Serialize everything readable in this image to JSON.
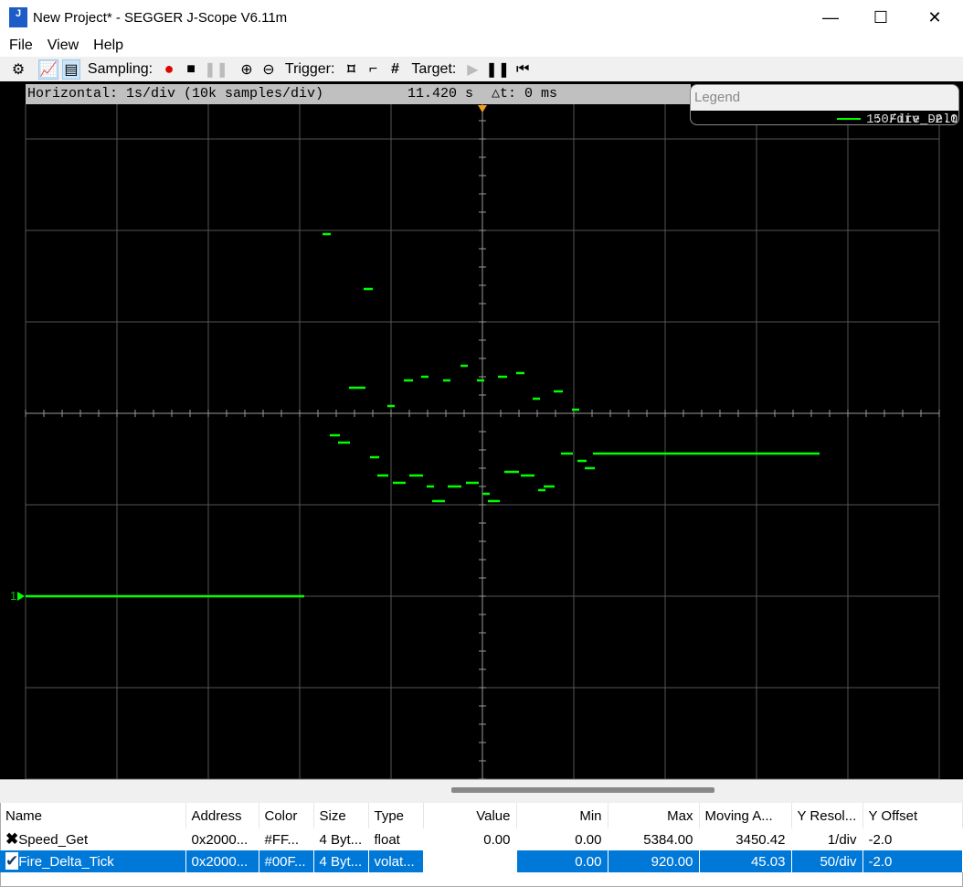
{
  "window": {
    "title": "New Project* - SEGGER J-Scope V6.11m",
    "icon_text": "J"
  },
  "menu": [
    "File",
    "View",
    "Help"
  ],
  "toolbar": {
    "sampling_label": "Sampling:",
    "trigger_label": "Trigger:",
    "target_label": "Target:"
  },
  "scope": {
    "horizontal": "Horizontal: 1s/div (10k samples/div)",
    "time": "11.420 s",
    "delta": "△t: 0 ms",
    "channel_marker": "1"
  },
  "legend": {
    "title": "Legend",
    "entry": "1: Fire_Delt",
    "entry_scale": "50/div -2.0"
  },
  "colors": {
    "trace": "#00ff00",
    "selection": "#0078d7",
    "trigger": "#f0a020"
  },
  "table": {
    "headers": [
      "Name",
      "Address",
      "Color",
      "Size",
      "Type",
      "Value",
      "Min",
      "Max",
      "Moving A...",
      "Y Resol...",
      "Y Offset"
    ],
    "rows": [
      {
        "checked": false,
        "cells": [
          "Speed_Get",
          "0x2000...",
          "#FF...",
          "4 Byt...",
          "float",
          "0.00",
          "0.00",
          "5384.00",
          "3450.42",
          "1/div",
          "-2.0"
        ]
      },
      {
        "checked": true,
        "selected": true,
        "cells": [
          "Fire_Delta_Tick",
          "0x2000...",
          "#00F...",
          "4 Byt...",
          "volat...",
          "",
          "0.00",
          "920.00",
          "45.03",
          "50/div",
          "-2.0"
        ]
      }
    ]
  },
  "chart_data": {
    "type": "line",
    "series": [
      {
        "name": "Fire_Delta_Tick",
        "y_per_div": 50,
        "y_offset_div": -2.0,
        "segments": [
          [
            6.42,
            9.47,
            0
          ],
          [
            9.67,
            9.76,
            198
          ],
          [
            10.12,
            10.22,
            168
          ],
          [
            9.96,
            10.14,
            114
          ],
          [
            10.38,
            10.46,
            104
          ],
          [
            10.56,
            10.66,
            118
          ],
          [
            10.75,
            10.83,
            120
          ],
          [
            10.99,
            11.07,
            118
          ],
          [
            11.18,
            11.26,
            126
          ],
          [
            11.36,
            11.44,
            118
          ],
          [
            11.59,
            11.69,
            120
          ],
          [
            11.79,
            11.88,
            122
          ],
          [
            11.97,
            12.05,
            108
          ],
          [
            12.2,
            12.3,
            112
          ],
          [
            12.4,
            12.48,
            102
          ],
          [
            9.75,
            9.86,
            88
          ],
          [
            9.84,
            9.97,
            84
          ],
          [
            10.19,
            10.29,
            76
          ],
          [
            10.27,
            10.39,
            66
          ],
          [
            10.44,
            10.58,
            62
          ],
          [
            10.62,
            10.77,
            66
          ],
          [
            10.81,
            10.89,
            60
          ],
          [
            10.87,
            11.01,
            52
          ],
          [
            11.04,
            11.19,
            60
          ],
          [
            11.24,
            11.38,
            62
          ],
          [
            11.42,
            11.5,
            56
          ],
          [
            11.48,
            11.61,
            52
          ],
          [
            11.66,
            11.82,
            68
          ],
          [
            11.84,
            11.99,
            66
          ],
          [
            12.03,
            12.11,
            58
          ],
          [
            12.09,
            12.21,
            60
          ],
          [
            12.28,
            12.41,
            78
          ],
          [
            12.46,
            12.56,
            74
          ],
          [
            12.54,
            12.65,
            70
          ],
          [
            12.63,
            15.11,
            78
          ]
        ]
      }
    ],
    "x_center": 11.42,
    "x_per_div": 1,
    "xlabel": "s",
    "grid": true
  }
}
